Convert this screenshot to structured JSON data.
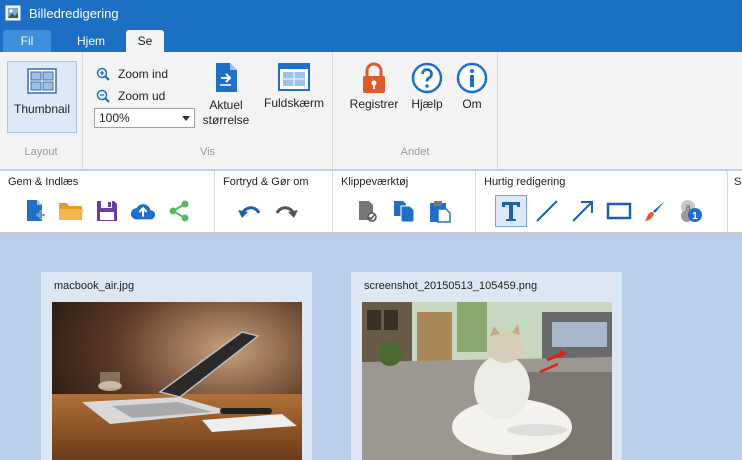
{
  "window": {
    "title": "Billedredigering"
  },
  "tabs": [
    {
      "label": "Fil"
    },
    {
      "label": "Hjem"
    },
    {
      "label": "Se"
    }
  ],
  "ribbon": {
    "layout": {
      "thumbnail_label": "Thumbnail",
      "group_label": "Layout"
    },
    "vis": {
      "zoom_in_label": "Zoom ind",
      "zoom_out_label": "Zoom ud",
      "zoom_value": "100%",
      "actual_size_label_1": "Aktuel",
      "actual_size_label_2": "størrelse",
      "fullscreen_label": "Fuldskærm",
      "group_label": "Vis"
    },
    "andet": {
      "register_label": "Registrer",
      "help_label": "Hjælp",
      "about_label": "Om",
      "group_label": "Andet"
    }
  },
  "toolbar": {
    "groups": [
      {
        "label": "Gem & Indlæs"
      },
      {
        "label": "Fortryd & Gør om"
      },
      {
        "label": "Klippeværktøj"
      },
      {
        "label": "Hurtig redigering"
      },
      {
        "label": "Sa"
      }
    ]
  },
  "thumbnails": [
    {
      "filename": "macbook_air.jpg"
    },
    {
      "filename": "screenshot_20150513_105459.png"
    }
  ],
  "colors": {
    "title_bar": "#1d6fc4",
    "ribbon_bg": "#f3f3f3",
    "workspace_bg": "#b9cfe8",
    "icon_blue": "#1f6fc8",
    "icon_orange": "#f0a030",
    "icon_purple": "#6b3fa0",
    "icon_green": "#5cb85c",
    "lock_red": "#e05a2b"
  }
}
